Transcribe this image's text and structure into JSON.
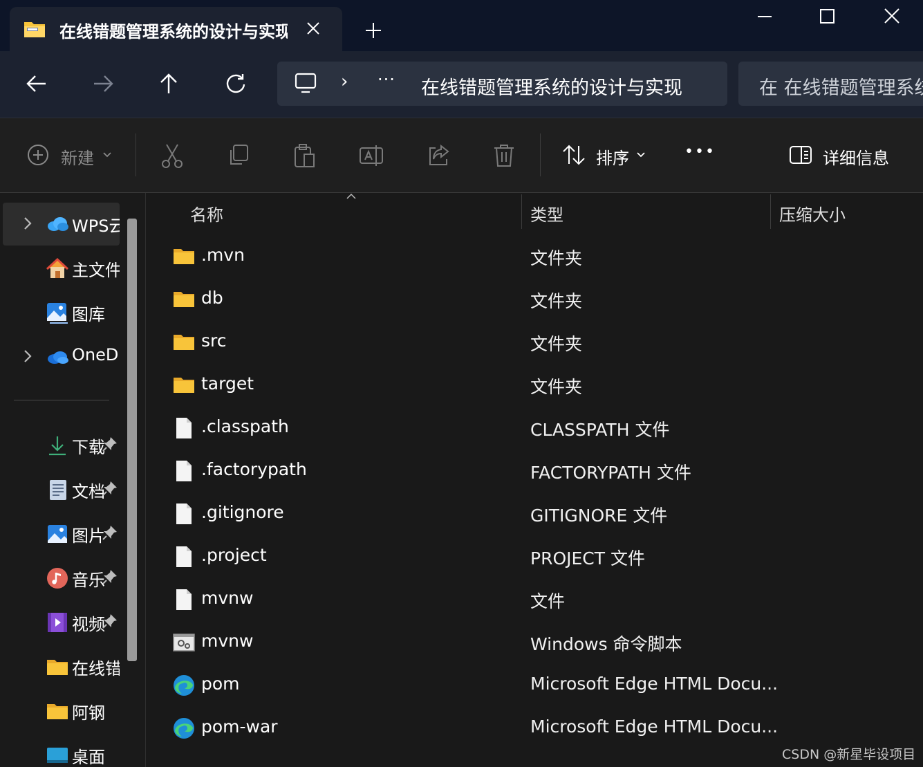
{
  "tab": {
    "title": "在线错题管理系统的设计与实现",
    "close_icon": "close-icon",
    "new_tab_icon": "plus-icon"
  },
  "window": {
    "minimize_icon": "minimize-icon",
    "maximize_icon": "maximize-icon",
    "close_icon": "close-icon"
  },
  "nav": {
    "back_icon": "arrow-left-icon",
    "forward_icon": "arrow-right-icon",
    "up_icon": "arrow-up-icon",
    "refresh_icon": "refresh-icon",
    "breadcrumb_root_icon": "monitor-icon",
    "breadcrumb_sep": "›",
    "breadcrumb_more": "···",
    "breadcrumb_current": "在线错题管理系统的设计与实现",
    "search_text": "在 在线错题管理系统"
  },
  "toolbar": {
    "new_label": "新建",
    "sort_label": "排序",
    "more_label": "•••",
    "details_label": "详细信息",
    "icons": [
      "cut-icon",
      "copy-icon",
      "paste-icon",
      "rename-icon",
      "share-icon",
      "delete-icon"
    ]
  },
  "sidebar": {
    "items": [
      {
        "label": "WPS云盘",
        "icon": "cloud-icon",
        "expandable": true
      },
      {
        "label": "主文件夹",
        "icon": "home-icon"
      },
      {
        "label": "图库",
        "icon": "gallery-icon"
      },
      {
        "label": "OneDrive",
        "icon": "onedrive-icon",
        "expandable": true
      },
      {
        "label": "下载",
        "icon": "download-icon",
        "pinned": true
      },
      {
        "label": "文档",
        "icon": "document-icon",
        "pinned": true
      },
      {
        "label": "图片",
        "icon": "pictures-icon",
        "pinned": true
      },
      {
        "label": "音乐",
        "icon": "music-icon",
        "pinned": true
      },
      {
        "label": "视频",
        "icon": "video-icon",
        "pinned": true
      },
      {
        "label": "在线错题管理系统的设计与实现",
        "icon": "folder-icon"
      },
      {
        "label": "阿钢",
        "icon": "folder-icon"
      },
      {
        "label": "桌面",
        "icon": "desktop-icon"
      }
    ]
  },
  "columns": {
    "name": "名称",
    "type": "类型",
    "size": "压缩大小"
  },
  "files": [
    {
      "name": ".mvn",
      "type": "文件夹",
      "icon": "folder-icon"
    },
    {
      "name": "db",
      "type": "文件夹",
      "icon": "folder-icon"
    },
    {
      "name": "src",
      "type": "文件夹",
      "icon": "folder-icon"
    },
    {
      "name": "target",
      "type": "文件夹",
      "icon": "folder-icon"
    },
    {
      "name": ".classpath",
      "type": "CLASSPATH 文件",
      "icon": "file-icon"
    },
    {
      "name": ".factorypath",
      "type": "FACTORYPATH 文件",
      "icon": "file-icon"
    },
    {
      "name": ".gitignore",
      "type": "GITIGNORE 文件",
      "icon": "file-icon"
    },
    {
      "name": ".project",
      "type": "PROJECT 文件",
      "icon": "file-icon"
    },
    {
      "name": "mvnw",
      "type": "文件",
      "icon": "file-icon"
    },
    {
      "name": "mvnw",
      "type": "Windows 命令脚本",
      "icon": "script-icon"
    },
    {
      "name": "pom",
      "type": "Microsoft Edge HTML Docu...",
      "icon": "edge-icon"
    },
    {
      "name": "pom-war",
      "type": "Microsoft Edge HTML Docu...",
      "icon": "edge-icon"
    }
  ],
  "watermark": "CSDN @新星毕设项目",
  "colors": {
    "accent": "#0078d4",
    "folder": "#f8c43a",
    "bg": "#191919",
    "titlebar": "#0d1528",
    "navbar": "#1c2230"
  }
}
